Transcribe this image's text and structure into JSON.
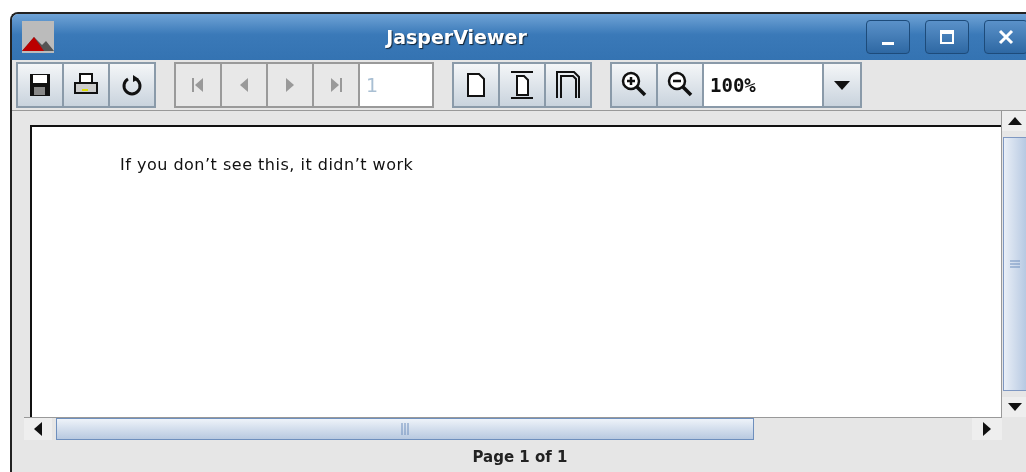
{
  "window": {
    "title": "JasperViewer"
  },
  "toolbar": {
    "groups": [
      {
        "buttons": [
          {
            "kind": "save",
            "disabled": false
          },
          {
            "kind": "print",
            "disabled": false
          },
          {
            "kind": "reload",
            "disabled": false
          }
        ]
      },
      {
        "buttons": [
          {
            "kind": "first",
            "disabled": true
          },
          {
            "kind": "previous",
            "disabled": true
          },
          {
            "kind": "next",
            "disabled": true
          },
          {
            "kind": "last",
            "disabled": true
          }
        ],
        "page_field": {
          "value": "1",
          "disabled": true
        }
      },
      {
        "buttons": [
          {
            "kind": "actual-size",
            "disabled": false
          },
          {
            "kind": "fit-page",
            "disabled": false
          },
          {
            "kind": "fit-width",
            "disabled": false
          }
        ]
      },
      {
        "buttons": [
          {
            "kind": "zoom-in",
            "disabled": false
          },
          {
            "kind": "zoom-out",
            "disabled": false
          }
        ],
        "zoom_field": {
          "value": "100%"
        }
      }
    ]
  },
  "report": {
    "text": "If you don’t see this, it didn’t work"
  },
  "status_bar": {
    "text": "Page 1 of 1"
  }
}
